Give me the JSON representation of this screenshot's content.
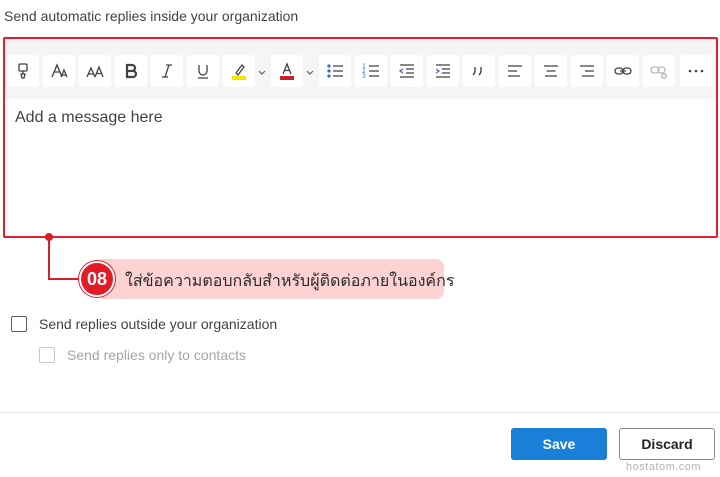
{
  "section_title": "Send automatic replies inside your organization",
  "editor": {
    "placeholder": "Add a message here",
    "toolbar": [
      {
        "name": "format-painter-icon",
        "title": "Format painter"
      },
      {
        "name": "font-icon",
        "title": "Font"
      },
      {
        "name": "font-size-icon",
        "title": "Font size"
      },
      {
        "name": "bold-icon",
        "title": "Bold"
      },
      {
        "name": "italic-icon",
        "title": "Italic"
      },
      {
        "name": "underline-icon",
        "title": "Underline"
      },
      {
        "name": "highlight-icon",
        "title": "Highlight"
      },
      {
        "name": "font-color-icon",
        "title": "Font color"
      },
      {
        "name": "bullets-icon",
        "title": "Bullets"
      },
      {
        "name": "numbering-icon",
        "title": "Numbering"
      },
      {
        "name": "decrease-indent-icon",
        "title": "Decrease indent"
      },
      {
        "name": "increase-indent-icon",
        "title": "Increase indent"
      },
      {
        "name": "quote-icon",
        "title": "Quote"
      },
      {
        "name": "align-left-icon",
        "title": "Align left"
      },
      {
        "name": "align-center-icon",
        "title": "Align center"
      },
      {
        "name": "align-right-icon",
        "title": "Align right"
      },
      {
        "name": "link-icon",
        "title": "Insert link"
      },
      {
        "name": "unlink-icon",
        "title": "Remove link"
      },
      {
        "name": "more-options-icon",
        "title": "More options"
      }
    ],
    "highlight_color": "#f2e600",
    "font_color": "#c8202a"
  },
  "callout": {
    "number": "08",
    "text": "ใส่ข้อความตอบกลับสำหรับผู้ติดต่อภายในองค์กร",
    "color": "#e21c26"
  },
  "options": {
    "outside_label": "Send replies outside your organization",
    "outside_checked": false,
    "contacts_only_label": "Send replies only to contacts",
    "contacts_only_checked": false
  },
  "actions": {
    "save_label": "Save",
    "discard_label": "Discard"
  },
  "watermark": "hostatom.com"
}
